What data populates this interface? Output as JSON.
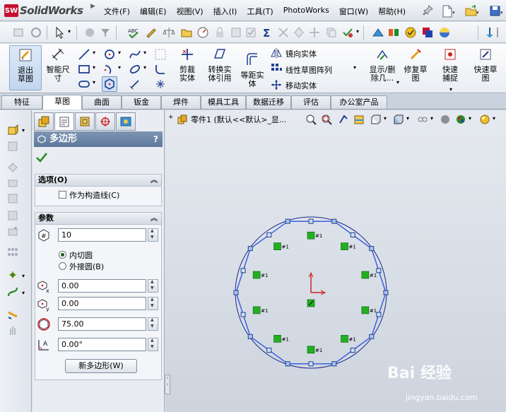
{
  "app": {
    "name": "SolidWorks",
    "logo_mark": "SW"
  },
  "menu": [
    "文件(F)",
    "编辑(E)",
    "视图(V)",
    "插入(I)",
    "工具(T)",
    "PhotoWorks",
    "窗口(W)",
    "帮助(H)"
  ],
  "command_manager": {
    "exit_sketch": "退出草图",
    "smart_dim": "智能尺寸",
    "trim": "剪裁实体",
    "convert": "转换实体引用",
    "offset": "等距实体",
    "mirror": "镜向实体",
    "linear_pattern": "线性草图阵列",
    "move": "移动实体",
    "display_delete": "显示/删除几...",
    "repair": "修复草图",
    "quick_snap": "快速捕捉",
    "rapid_sketch": "快速草图"
  },
  "tabs": [
    "特征",
    "草图",
    "曲面",
    "钣金",
    "焊件",
    "模具工具",
    "数据迁移",
    "评估",
    "办公室产品"
  ],
  "active_tab": "草图",
  "property_manager": {
    "title": "多边形",
    "help": "?",
    "options_group": {
      "title": "选项(O)",
      "construction_label": "作为构造线(C)",
      "construction_checked": false
    },
    "params_group": {
      "title": "参数",
      "sides": "10",
      "inscribed_label": "内切圆",
      "circumscribed_label": "外接圆(B)",
      "inscribed_selected": true,
      "center_x": "0.00",
      "center_y": "0.00",
      "diameter": "75.00",
      "angle": "0.00°",
      "new_polygon_button": "新多边形(W)"
    }
  },
  "graphics": {
    "tree_text": "零件1  (默认<<默认>_显...",
    "constraint_tag": "#1",
    "sketch_color": "#3a5fe0",
    "circle_color": "#1a2a8a"
  },
  "watermark": {
    "brand": "Bai 经验",
    "url": "jingyan.baidu.com"
  }
}
